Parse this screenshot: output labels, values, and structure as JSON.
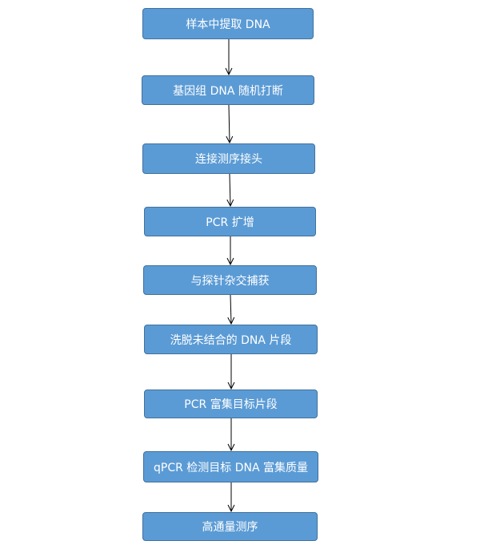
{
  "flowchart": {
    "steps": [
      {
        "label": "样本中提取 DNA"
      },
      {
        "label": "基因组 DNA 随机打断"
      },
      {
        "label": "连接测序接头"
      },
      {
        "label": "PCR 扩增"
      },
      {
        "label": "与探针杂交捕获"
      },
      {
        "label": "洗脱未结合的 DNA 片段"
      },
      {
        "label": "PCR 富集目标片段"
      },
      {
        "label": "qPCR 检测目标 DNA 富集质量"
      },
      {
        "label": "高通量测序"
      }
    ],
    "colors": {
      "box_fill": "#5b9bd5",
      "box_border": "#41719c",
      "box_text": "#ffffff",
      "arrow": "#000000"
    }
  }
}
